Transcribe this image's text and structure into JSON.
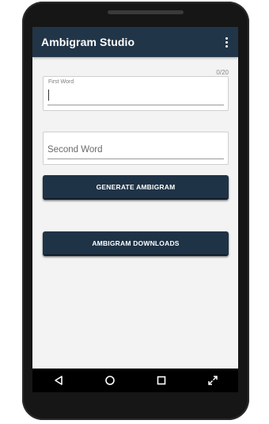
{
  "appbar": {
    "title": "Ambigram Studio",
    "menu_icon": "overflow-menu-icon"
  },
  "form": {
    "first_word": {
      "label": "First Word",
      "value": "",
      "counter": "0/20"
    },
    "second_word": {
      "placeholder": "Second Word",
      "value": ""
    }
  },
  "buttons": {
    "generate": "GENERATE AMBIGRAM",
    "downloads": "AMBIGRAM DOWNLOADS"
  },
  "navbar": {
    "icons": [
      "back-icon",
      "home-icon",
      "recents-icon",
      "fullscreen-icon"
    ]
  },
  "colors": {
    "primary": "#213548",
    "button": "#1f3346",
    "background": "#f3f3f3",
    "device": "#161616"
  }
}
